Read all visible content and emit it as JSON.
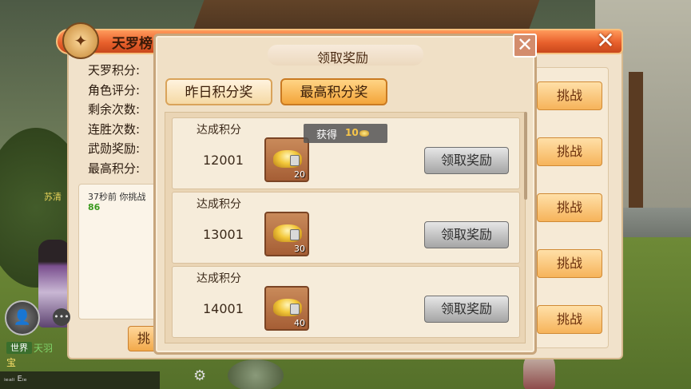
{
  "back_panel": {
    "title": "天罗榜",
    "emblem_icon": "crest-icon",
    "close_label": "✕",
    "stats": [
      "天罗积分:",
      "角色评分:",
      "剩余次数:",
      "连胜次数:",
      "武勋奖励:",
      "最高积分:"
    ],
    "log_text": "37秒前 你挑战",
    "log_value": "86",
    "side_name": "苏清",
    "left_button_label": "挑",
    "challenge_buttons": [
      "挑战",
      "挑战",
      "挑战",
      "挑战",
      "挑战"
    ]
  },
  "chat": {
    "channel_tag": "世界",
    "sender_name": "天羽",
    "next_line": "宝",
    "bottom_text": "ᵢₑₐₗᵢ Eᵢₑ"
  },
  "modal": {
    "title": "领取奖励",
    "close_label": "✕",
    "tabs": [
      {
        "label": "昨日积分奖",
        "active": false
      },
      {
        "label": "最高积分奖",
        "active": true
      }
    ],
    "toast": {
      "prefix": "获得",
      "amount": "10"
    },
    "rows": [
      {
        "label": "达成积分",
        "score": "12001",
        "item_count": "20",
        "claim_label": "领取奖励"
      },
      {
        "label": "达成积分",
        "score": "13001",
        "item_count": "30",
        "claim_label": "领取奖励"
      },
      {
        "label": "达成积分",
        "score": "14001",
        "item_count": "40",
        "claim_label": "领取奖励"
      }
    ]
  },
  "colors": {
    "header_orange": "#e8602c",
    "panel_beige": "#f0e0c6",
    "tab_active": "#f3a53a",
    "claim_button_grey": "#a5a5a5"
  }
}
